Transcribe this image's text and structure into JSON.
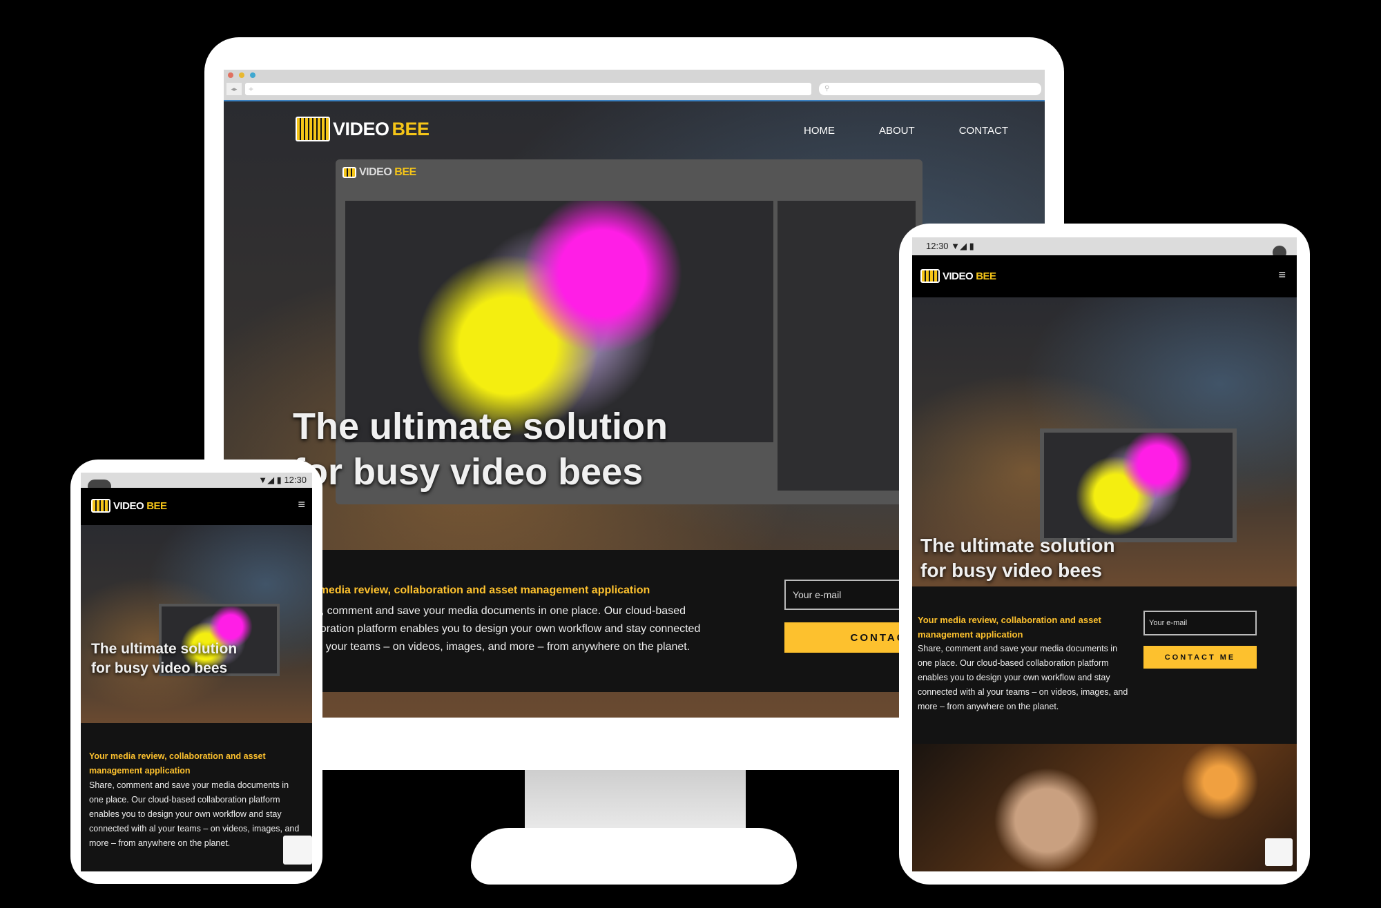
{
  "brand": {
    "logo_prefix": "VIDEO",
    "logo_suffix": "BEE"
  },
  "desktop": {
    "nav": [
      {
        "label": "HOME"
      },
      {
        "label": "ABOUT"
      },
      {
        "label": "CONTACT"
      }
    ],
    "hero_line1": "The ultimate solution",
    "hero_line2": "for busy video bees",
    "subtitle": "Your media review, collaboration and asset management application",
    "body_lines": [
      "Share, comment and save your media documents in one place. Our cloud-based",
      "collaboration platform enables you to design your own workflow and stay connected",
      "with al your teams – on videos, images, and more – from anywhere on the planet."
    ],
    "email_placeholder": "Your e-mail",
    "contact_button": "CONTACT ME"
  },
  "tablet": {
    "status_time": "12:30",
    "hero_line1": "The ultimate solution",
    "hero_line2": "for busy video bees",
    "subtitle": "Your media review, collaboration and asset management application",
    "body": "Share, comment and save your media documents in one place. Our cloud-based collaboration platform enables you to design your own workflow and stay connected with al your teams – on videos, images, and more – from anywhere on the planet.",
    "email_placeholder": "Your e-mail",
    "contact_button": "CONTACT ME"
  },
  "phone": {
    "status_time": "12:30",
    "hero_line1": "The ultimate solution",
    "hero_line2": "for busy video bees",
    "subtitle": "Your media review, collaboration and asset management application",
    "body": "Share, comment and save your media documents in one place. Our cloud-based collaboration platform enables you to design your own workflow and stay connected with al your teams – on videos, images, and more – from anywhere on the planet."
  },
  "colors": {
    "accent": "#fdc12e",
    "dark_band": "#131313"
  }
}
